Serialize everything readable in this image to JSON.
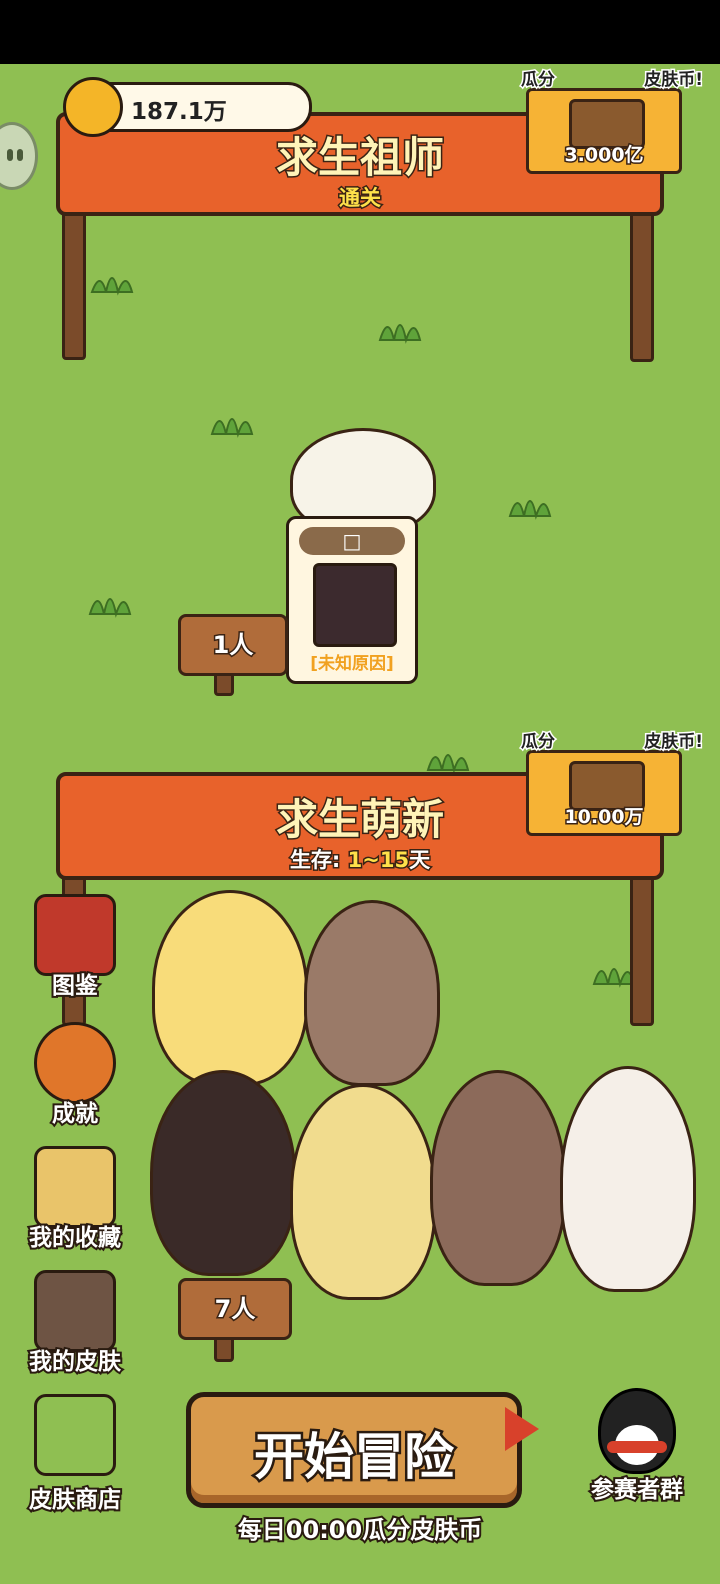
{
  "currency": {
    "amount": "187.1万",
    "icon": "coin-icon"
  },
  "top_banner": {
    "title": "求生祖师",
    "subtitle": "通关"
  },
  "top_reward": {
    "label_left": "瓜分",
    "label_right": "皮肤币!",
    "amount": "3.000亿"
  },
  "card": {
    "header": "□",
    "caption": "[未知原因]"
  },
  "sign1": {
    "text": "1人"
  },
  "bottom_banner": {
    "title": "求生萌新",
    "subtitle_prefix": "生存:",
    "subtitle_range": "1~15",
    "subtitle_suffix": "天"
  },
  "bottom_reward": {
    "label_left": "瓜分",
    "label_right": "皮肤币!",
    "amount": "10.00万"
  },
  "sign2": {
    "text": "7人"
  },
  "side_menu": [
    {
      "label": "图鉴",
      "icon": "book-icon"
    },
    {
      "label": "成就",
      "icon": "medal-icon"
    },
    {
      "label": "我的收藏",
      "icon": "chest-icon"
    },
    {
      "label": "我的皮肤",
      "icon": "shirt-icon"
    }
  ],
  "shop": {
    "label": "皮肤商店",
    "icon": "cart-icon"
  },
  "start_button": {
    "label": "开始冒险"
  },
  "group": {
    "label": "参赛者群",
    "icon": "penguin-icon"
  },
  "footer": {
    "text": "每日00:00瓜分皮肤币"
  },
  "colors": {
    "grass": "#8fbf52",
    "banner": "#e8622b",
    "wood": "#b06c3a",
    "accent": "#f6b335"
  }
}
